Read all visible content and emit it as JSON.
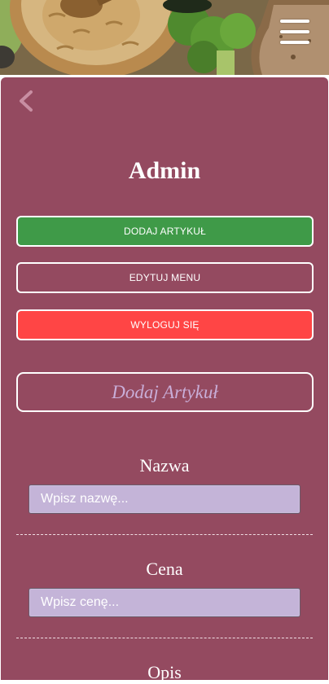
{
  "header": {
    "menu_icon": "hamburger-menu-icon"
  },
  "nav": {
    "back_icon": "chevron-left-icon"
  },
  "page": {
    "title": "Admin"
  },
  "actions": {
    "add_article": "DODAJ ARTYKUŁ",
    "edit_menu": "EDYTUJ MENU",
    "logout": "WYLOGUJ SIĘ"
  },
  "form": {
    "section_title": "Dodaj Artykuł",
    "name_label": "Nazwa",
    "name_placeholder": "Wpisz nazwę...",
    "price_label": "Cena",
    "price_placeholder": "Wpisz cenę...",
    "next_label": "Opis"
  },
  "colors": {
    "panel": "#944a60",
    "add_button": "#3f9a48",
    "logout_button": "#ff4545",
    "input_bg": "#c4b4d8",
    "section_text": "#c9aed8"
  }
}
